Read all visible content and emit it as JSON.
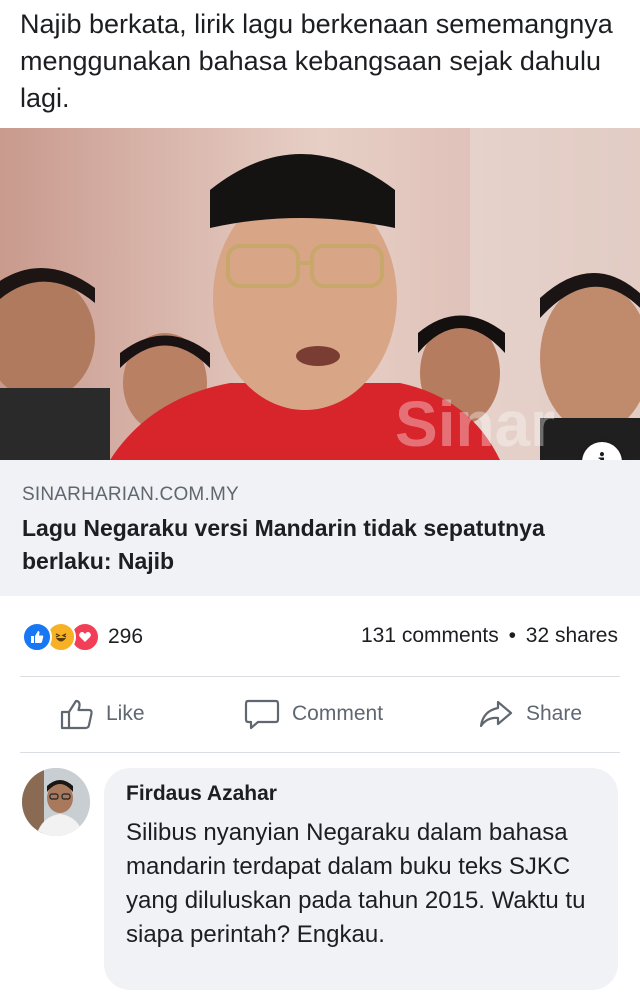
{
  "post": {
    "caption": "Najib berkata, lirik lagu berkenaan sememangnya menggunakan bahasa kebangsaan sejak dahulu lagi."
  },
  "link": {
    "domain": "SINARHARIAN.COM.MY",
    "title": "Lagu Negaraku versi Mandarin tidak sepatutnya berlaku: Najib",
    "image_icon": "info-icon"
  },
  "reactions": {
    "types": [
      "like",
      "haha",
      "love"
    ],
    "count": "296",
    "comments": "131 comments",
    "separator": "•",
    "shares": "32 shares",
    "colors": {
      "like": "#1877f2",
      "haha": "#f7b125",
      "love": "#f33e58"
    }
  },
  "actions": {
    "like": "Like",
    "comment": "Comment",
    "share": "Share"
  },
  "comment": {
    "author": "Firdaus Azahar",
    "text": "Silibus nyanyian Negaraku dalam bahasa mandarin terdapat dalam buku teks SJKC yang diluluskan pada tahun 2015. Waktu tu siapa perintah? Engkau."
  }
}
